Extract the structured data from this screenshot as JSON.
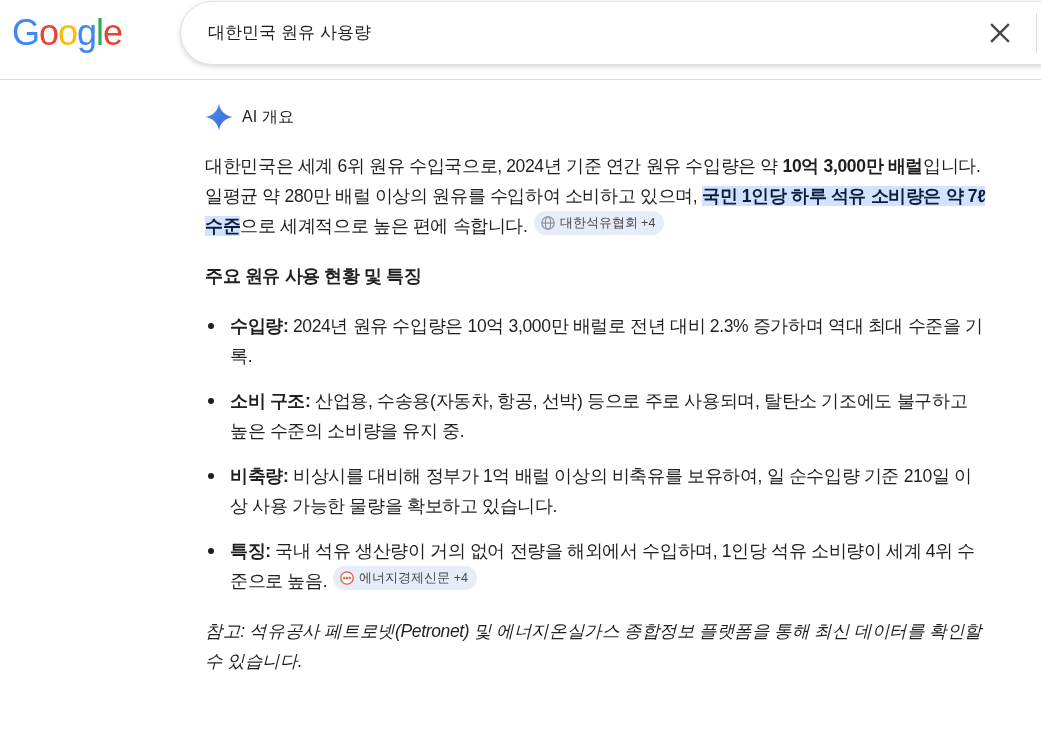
{
  "header": {
    "logo": "Google",
    "search": {
      "value": "대한민국 원유 사용량"
    }
  },
  "ai_overview": {
    "title": "AI 개요",
    "summary": {
      "segments": [
        {
          "text": "대한민국은 세계 6위 원유 수입국으로, 2024년 기준 연간 원유 수입량은 약 **10억 3,000만 배럴**입니다. 일평균 약 280만 배럴 이상의 원유를 수입하여 소비하고 있으며, ",
          "highlighted": false
        },
        {
          "text": "국민 1인당 하루 석유 소비량은 약 7ℓ 수준",
          "highlighted": true
        },
        {
          "text": "으로 세계적으로 높은 편에 속합니다.",
          "highlighted": false
        }
      ],
      "citation": {
        "label": "대한석유협회 +4"
      }
    },
    "heading": "주요 원유 사용 현황 및 특징",
    "items": [
      {
        "text": "**수입량:** 2024년 원유 수입량은 10억 3,000만 배럴로 전년 대비 2.3% 증가하며 역대 최대 수준을 기록."
      },
      {
        "text": "**소비 구조:** 산업용, 수송용(자동차, 항공, 선박) 등으로 주로 사용되며, 탈탄소 기조에도 불구하고 높은 수준의 소비량을 유지 중."
      },
      {
        "text": "**비축량:** 비상시를 대비해 정부가 1억 배럴 이상의 비축유를 보유하여, 일 순수입량 기준 210일 이상 사용 가능한 물량을 확보하고 있습니다."
      },
      {
        "text": "**특징:** 국내 석유 생산량이 거의 없어 전량을 해외에서 수입하며, 1인당 석유 소비량이 세계 4위 수준으로 높음.",
        "citation": {
          "label": "에너지경제신문 +4"
        }
      }
    ],
    "note": "참고: 석유공사 페트로넷(Petronet) 및 에너지온실가스 종합정보 플랫폼을 통해 최신 데이터를 확인할 수 있습니다."
  }
}
